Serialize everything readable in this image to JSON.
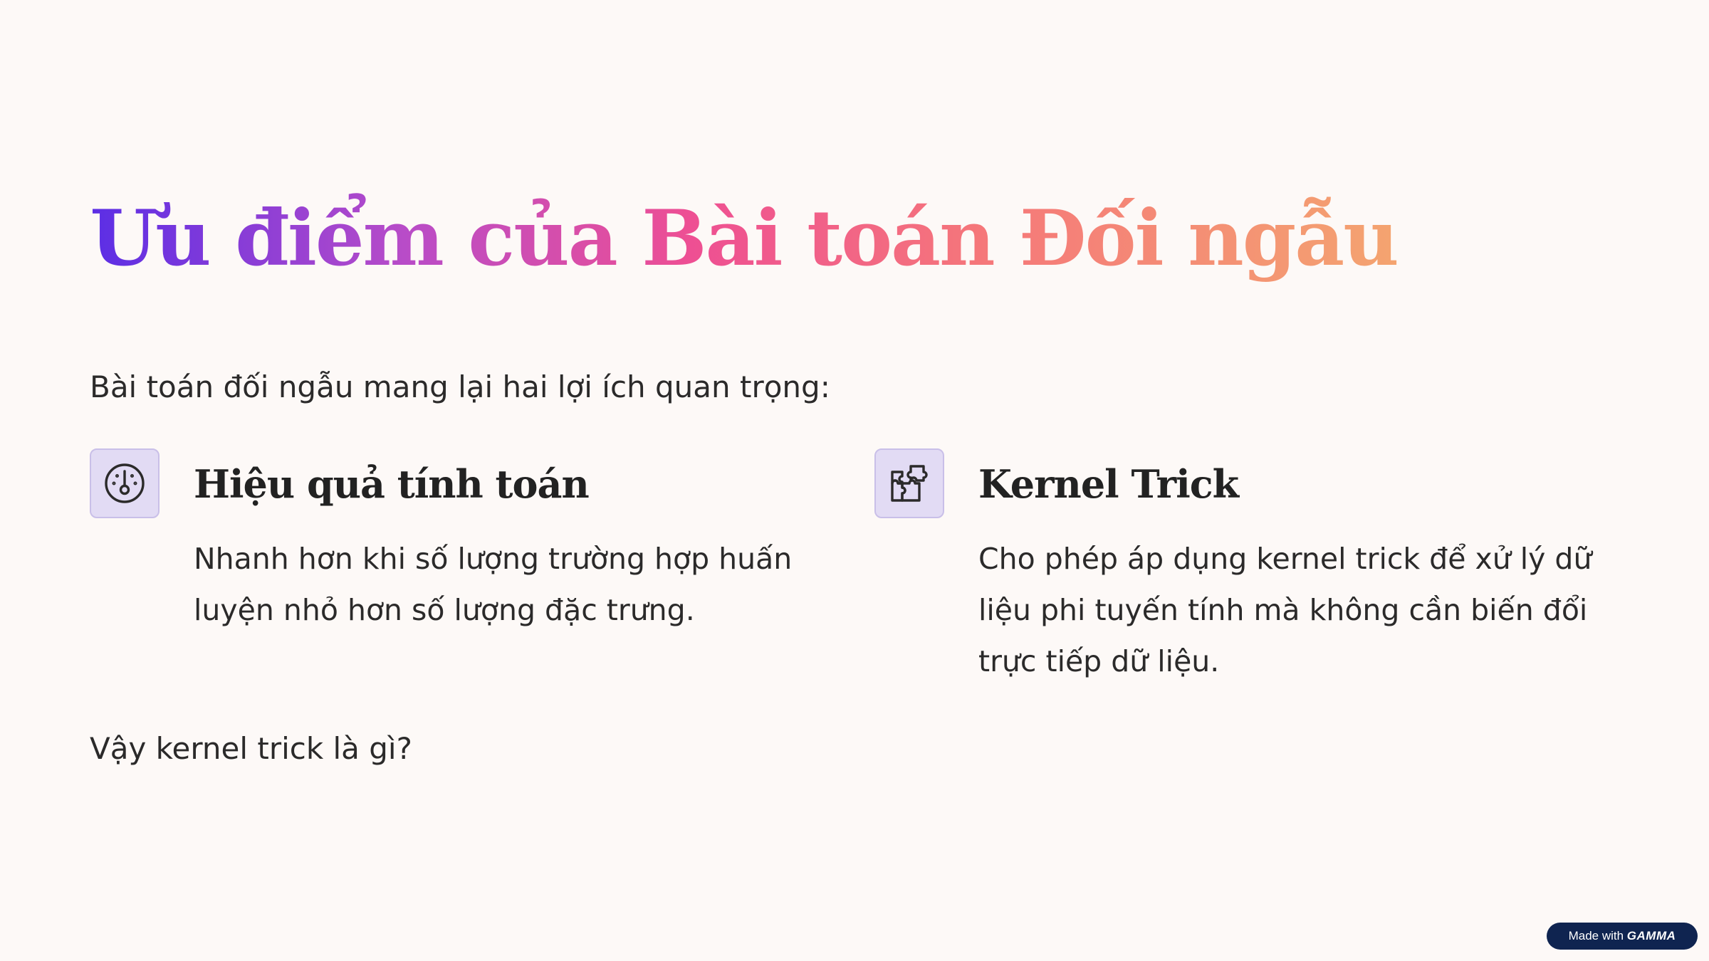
{
  "slide": {
    "title": "Ưu điểm của Bài toán Đối ngẫu",
    "intro": "Bài toán đối ngẫu mang lại hai lợi ích quan trọng:",
    "cards": [
      {
        "icon": "gauge-icon",
        "title": "Hiệu quả tính toán",
        "text": "Nhanh hơn khi số lượng trường hợp huấn luyện nhỏ hơn số lượng đặc trưng."
      },
      {
        "icon": "puzzle-icon",
        "title": "Kernel Trick",
        "text": "Cho phép áp dụng kernel trick để xử lý dữ liệu phi tuyến tính mà không cần biến đổi trực tiếp dữ liệu."
      }
    ],
    "outro": "Vậy kernel trick là gì?"
  },
  "badge": {
    "prefix": "Made with",
    "brand": "GAMMA"
  },
  "colors": {
    "background": "#fdf9f7",
    "title_gradient": [
      "#5b2ee5",
      "#b84cc8",
      "#ee4f93",
      "#f5777a",
      "#f4a470"
    ],
    "icon_bg": "#e2dbf4",
    "text": "#2b2a2a",
    "badge_bg": "#0f2450"
  }
}
